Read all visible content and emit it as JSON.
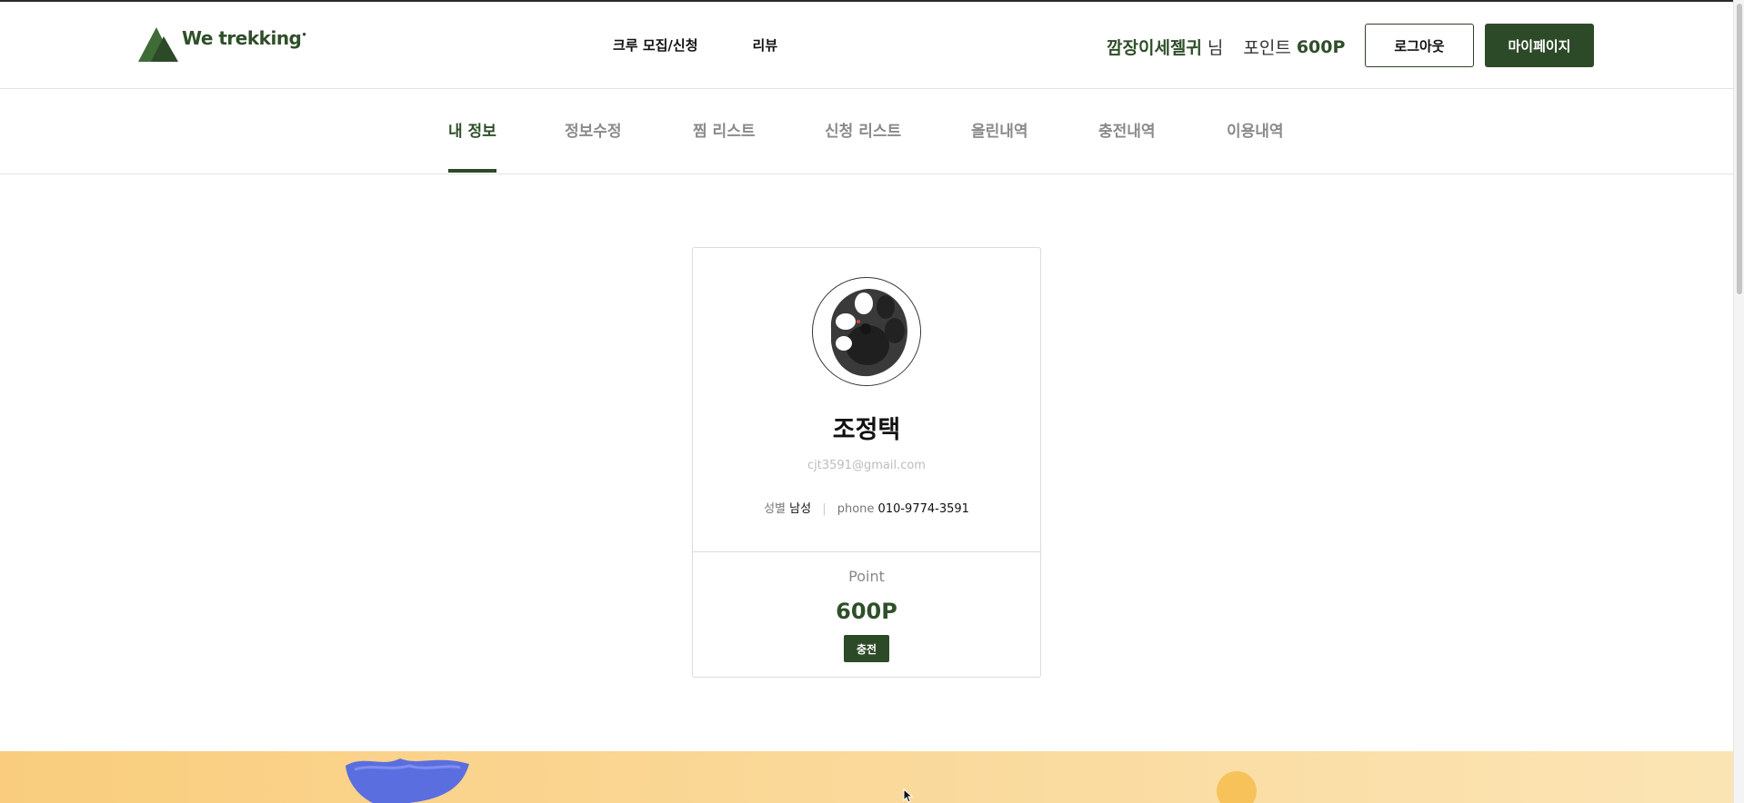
{
  "header": {
    "logo_text": "We trekking",
    "nav": [
      "크루 모집/신청",
      "리뷰"
    ],
    "user_name": "깜장이세젤귀",
    "user_suffix": "님",
    "point_label": "포인트",
    "point_value": "600P",
    "logout_label": "로그아웃",
    "mypage_label": "마이페이지"
  },
  "tabs": [
    "내 정보",
    "정보수정",
    "찜 리스트",
    "신청 리스트",
    "올린내역",
    "충전내역",
    "이용내역"
  ],
  "active_tab": "내 정보",
  "profile": {
    "name": "조정택",
    "email": "cjt3591@gmail.com",
    "gender_label": "성별",
    "gender_value": "남성",
    "phone_label": "phone",
    "phone_value": "010-9774-3591"
  },
  "points": {
    "title": "Point",
    "value": "600P",
    "charge_label": "충전"
  },
  "colors": {
    "brand": "#2d4a28",
    "banner": "#fad99a"
  }
}
